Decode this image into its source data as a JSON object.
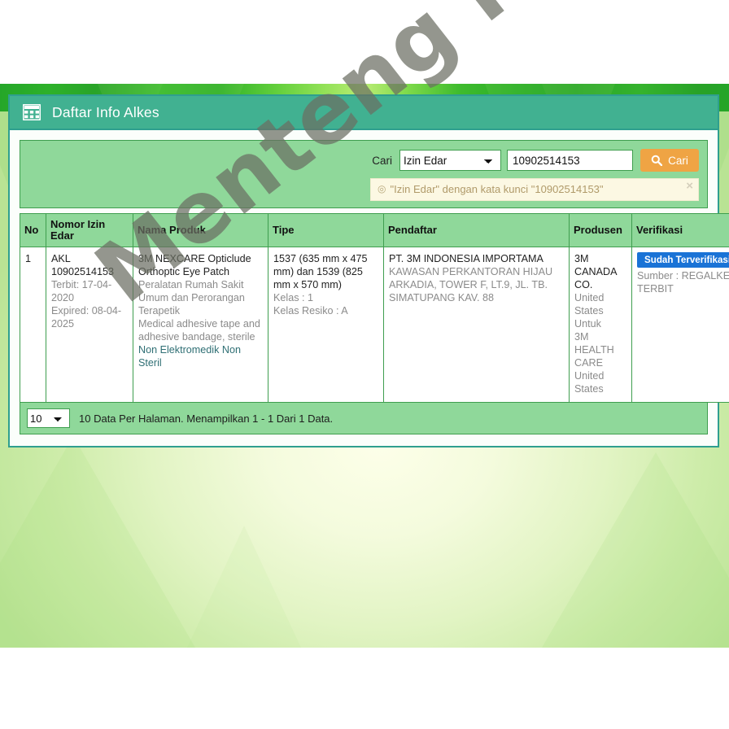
{
  "panel": {
    "title": "Daftar Info Alkes",
    "icon": "table-grid-icon"
  },
  "search": {
    "label": "Cari",
    "category_selected": "Izin Edar",
    "category_options": [
      "Izin Edar"
    ],
    "query_value": "10902514153",
    "query_placeholder": "",
    "button_label": "Cari",
    "button_icon": "search-icon",
    "button_color": "#efa444"
  },
  "alert": {
    "icon": "info-circle-icon",
    "text": "\"Izin Edar\" dengan kata kunci \"10902514153\"",
    "close_label": "×",
    "bg_color": "#fcf8e3",
    "text_color": "#b09a6a"
  },
  "table": {
    "headers": {
      "no": "No",
      "nomor_izin_edar": "Nomor Izin Edar",
      "nama_produk": "Nama Produk",
      "tipe": "Tipe",
      "pendaftar": "Pendaftar",
      "produsen": "Produsen",
      "verifikasi": "Verifikasi"
    },
    "rows": [
      {
        "no": "1",
        "izin": {
          "kode": "AKL",
          "nomor": "10902514153",
          "terbit": "Terbit: 17-04-2020",
          "expired": "Expired: 08-04-2025"
        },
        "produk": {
          "nama": "3M NEXCARE Opticlude Orthoptic Eye Patch",
          "kategori": "Peralatan Rumah Sakit Umum dan Perorangan Terapetik",
          "deskripsi": "Medical adhesive tape and adhesive bandage, sterile",
          "klasifikasi": "Non Elektromedik Non Steril"
        },
        "tipe": {
          "dimensi": "1537 (635 mm x 475 mm) dan 1539 (825 mm x 570 mm)",
          "kelas": "Kelas : 1",
          "kelas_resiko": "Kelas Resiko : A"
        },
        "pendaftar": {
          "nama": "PT. 3M INDONESIA IMPORTAMA",
          "alamat": "KAWASAN PERKANTORAN HIJAU ARKADIA, TOWER F, LT.9, JL. TB. SIMATUPANG KAV. 88"
        },
        "produsen": {
          "nama": "3M CANADA CO.",
          "negara": "United States",
          "untuk_label": "Untuk",
          "untuk_nama": "3M HEALTH CARE",
          "untuk_negara": "United States"
        },
        "verifikasi": {
          "badge": "Sudah Terverifikasi",
          "badge_color": "#1a73d6",
          "sumber": "Sumber : REGALKES TERBIT"
        }
      }
    ]
  },
  "footer": {
    "per_page_selected": "10",
    "per_page_options": [
      "10"
    ],
    "info": "10 Data Per Halaman. Menampilkan 1 - 1 Dari 1 Data."
  },
  "watermark": {
    "text": "Menteng Farma"
  }
}
